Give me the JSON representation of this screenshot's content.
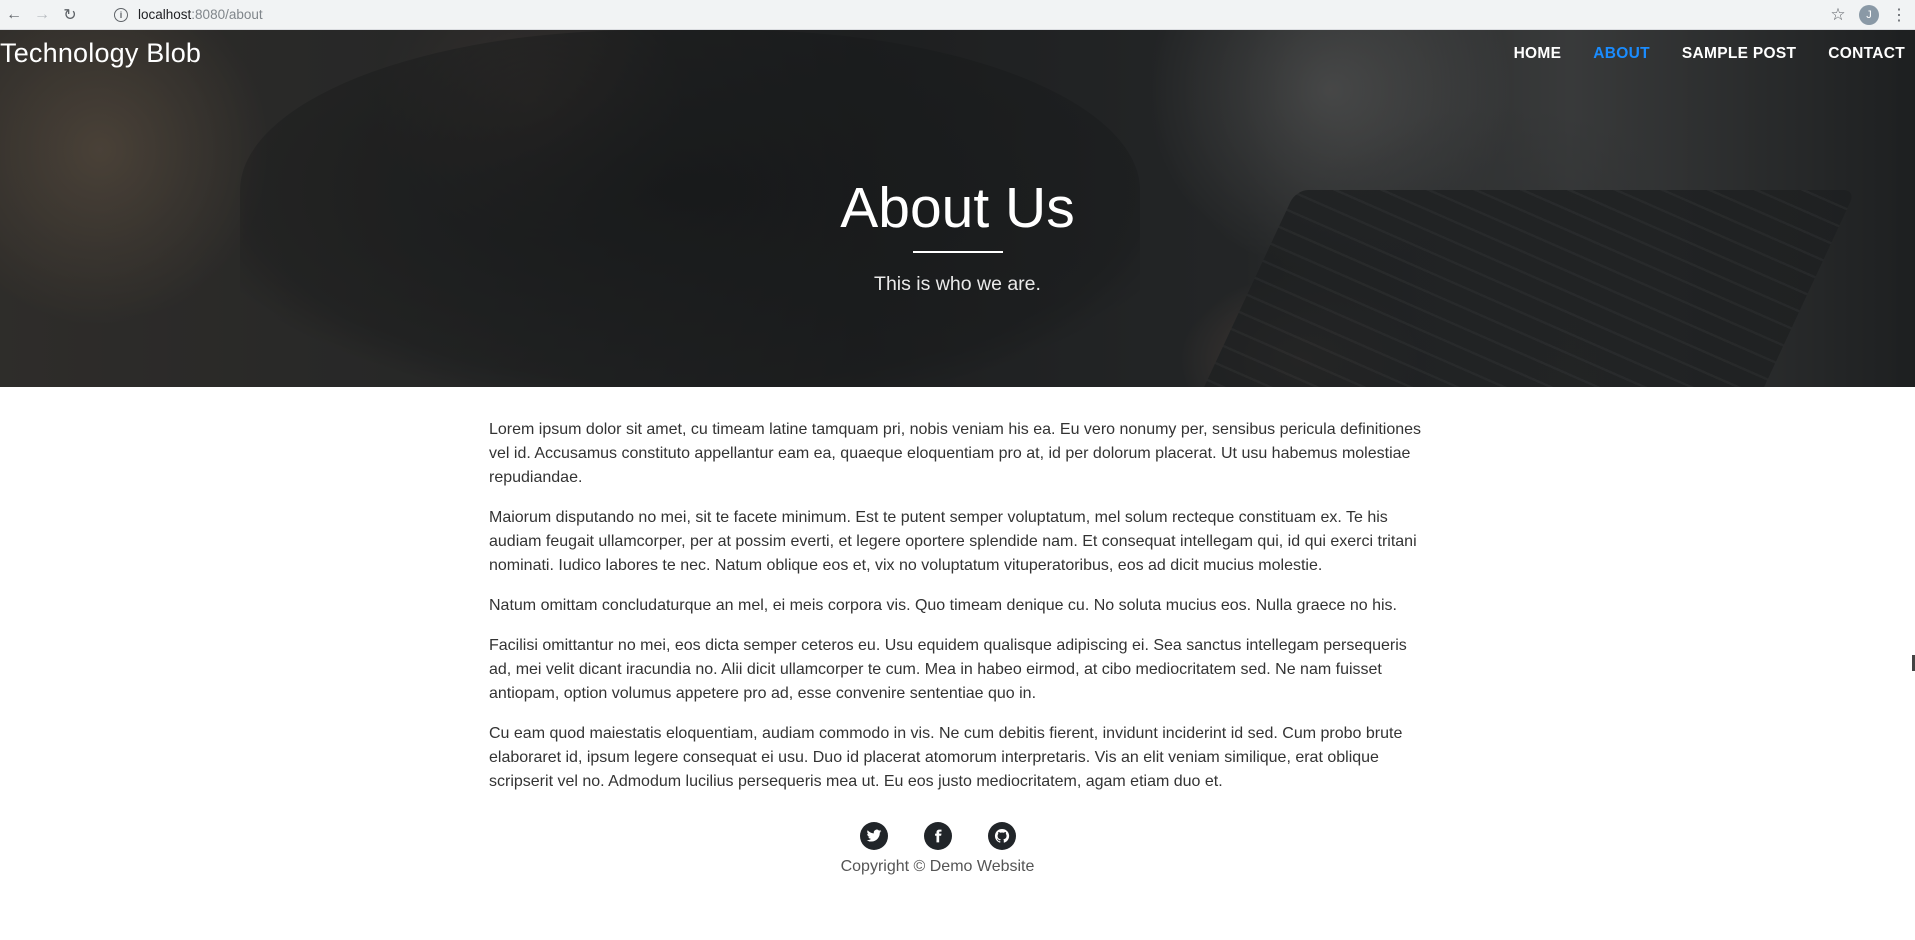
{
  "browser": {
    "url_host": "localhost",
    "url_path": ":8080/about",
    "profile_initial": "J"
  },
  "header": {
    "brand": "Technology Blob",
    "nav": [
      {
        "label": "HOME",
        "active": false
      },
      {
        "label": "ABOUT",
        "active": true
      },
      {
        "label": "SAMPLE POST",
        "active": false
      },
      {
        "label": "CONTACT",
        "active": false
      }
    ],
    "title": "About Us",
    "subtitle": "This is who we are."
  },
  "content": {
    "paragraphs": [
      "Lorem ipsum dolor sit amet, cu timeam latine tamquam pri, nobis veniam his ea. Eu vero nonumy per, sensibus pericula definitiones vel id. Accusamus constituto appellantur eam ea, quaeque eloquentiam pro at, id per dolorum placerat. Ut usu habemus molestiae repudiandae.",
      "Maiorum disputando no mei, sit te facete minimum. Est te putent semper voluptatum, mel solum recteque constituam ex. Te his audiam feugait ullamcorper, per at possim everti, et legere oportere splendide nam. Et consequat intellegam qui, id qui exerci tritani nominati. Iudico labores te nec. Natum oblique eos et, vix no voluptatum vituperatoribus, eos ad dicit mucius molestie.",
      "Natum omittam concludaturque an mel, ei meis corpora vis. Quo timeam denique cu. No soluta mucius eos. Nulla graece no his.",
      "Facilisi omittantur no mei, eos dicta semper ceteros eu. Usu equidem qualisque adipiscing ei. Sea sanctus intellegam persequeris ad, mei velit dicant iracundia no. Alii dicit ullamcorper te cum. Mea in habeo eirmod, at cibo mediocritatem sed. Ne nam fuisset antiopam, option volumus appetere pro ad, esse convenire sententiae quo in.",
      "Cu eam quod maiestatis eloquentiam, audiam commodo in vis. Ne cum debitis fierent, invidunt inciderint id sed. Cum probo brute elaboraret id, ipsum legere consequat ei usu. Duo id placerat atomorum interpretaris. Vis an elit veniam similique, erat oblique scripserit vel no. Admodum lucilius persequeris mea ut. Eu eos justo mediocritatem, agam etiam duo et."
    ]
  },
  "footer": {
    "social": [
      {
        "icon": "twitter-icon"
      },
      {
        "icon": "facebook-icon"
      },
      {
        "icon": "github-icon"
      }
    ],
    "copyright": "Copyright © Demo Website"
  },
  "colors": {
    "nav_active": "#1a8cff",
    "footer_icon_bg": "#212529"
  }
}
